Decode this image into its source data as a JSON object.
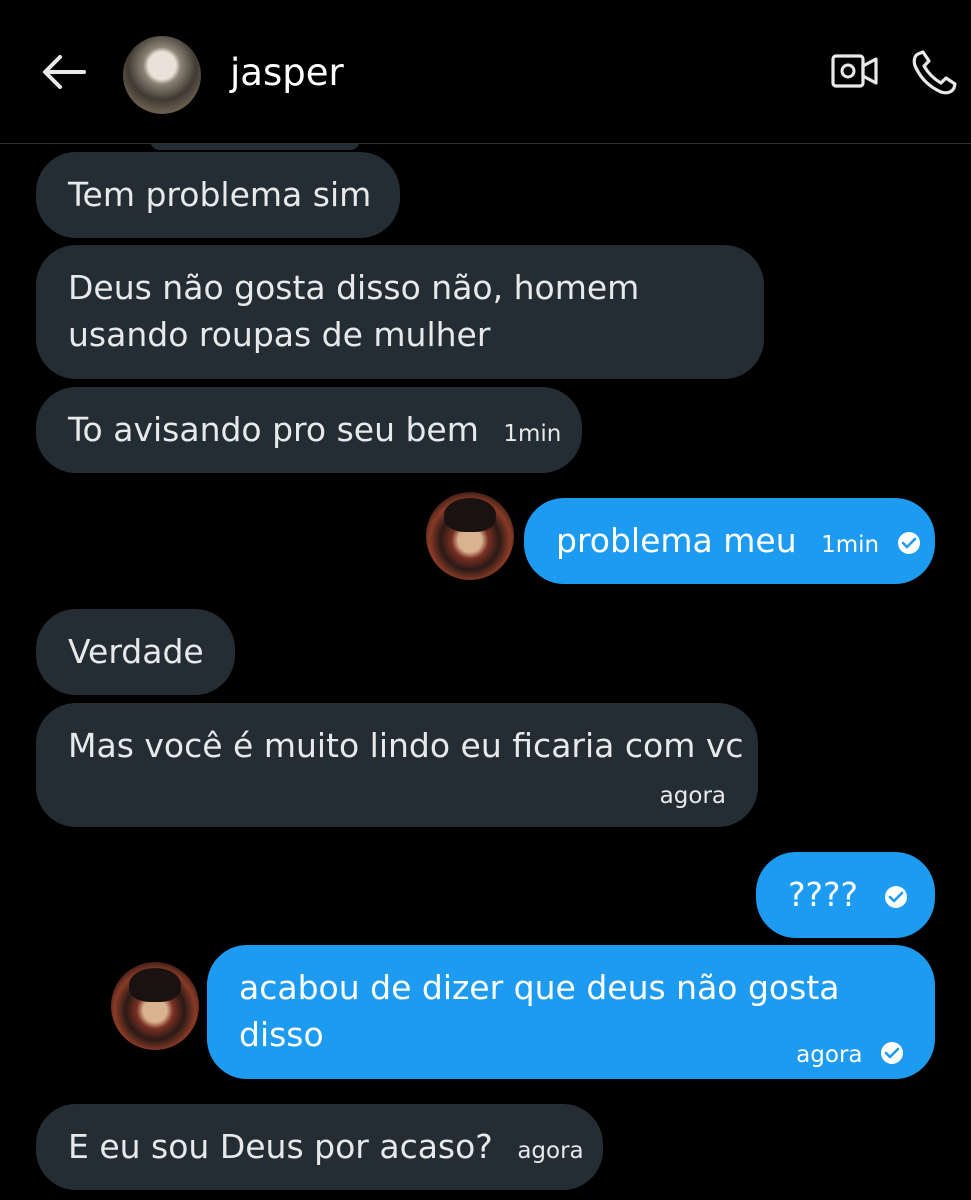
{
  "header": {
    "contact_name": "jasper",
    "back_icon": "arrow-left-icon",
    "video_icon": "video-call-icon",
    "phone_icon": "phone-call-icon"
  },
  "colors": {
    "background": "#000000",
    "incoming_bubble": "#242d34",
    "outgoing_bubble": "#1d9bf0",
    "text": "#e7e9ea"
  },
  "messages": [
    {
      "direction": "in",
      "text": "Tem problema sim",
      "time": ""
    },
    {
      "direction": "in",
      "text_lines": [
        "Deus não gosta disso não, homem",
        "usando roupas de mulher"
      ],
      "time": ""
    },
    {
      "direction": "in",
      "text": "To avisando pro seu bem",
      "time": "1min"
    },
    {
      "direction": "out",
      "text": "problema meu",
      "time": "1min",
      "status": "sent-check-icon"
    },
    {
      "direction": "in",
      "text": "Verdade",
      "time": ""
    },
    {
      "direction": "in",
      "text": "Mas você é muito lindo eu ficaria com vc",
      "time": "agora"
    },
    {
      "direction": "out",
      "text": "????",
      "time": "",
      "status": "sent-check-icon"
    },
    {
      "direction": "out",
      "text_lines": [
        "acabou de dizer que deus não gosta",
        "disso"
      ],
      "time": "agora",
      "status": "sent-check-icon"
    },
    {
      "direction": "in",
      "text": "E eu sou Deus por acaso?",
      "time": "agora"
    }
  ]
}
